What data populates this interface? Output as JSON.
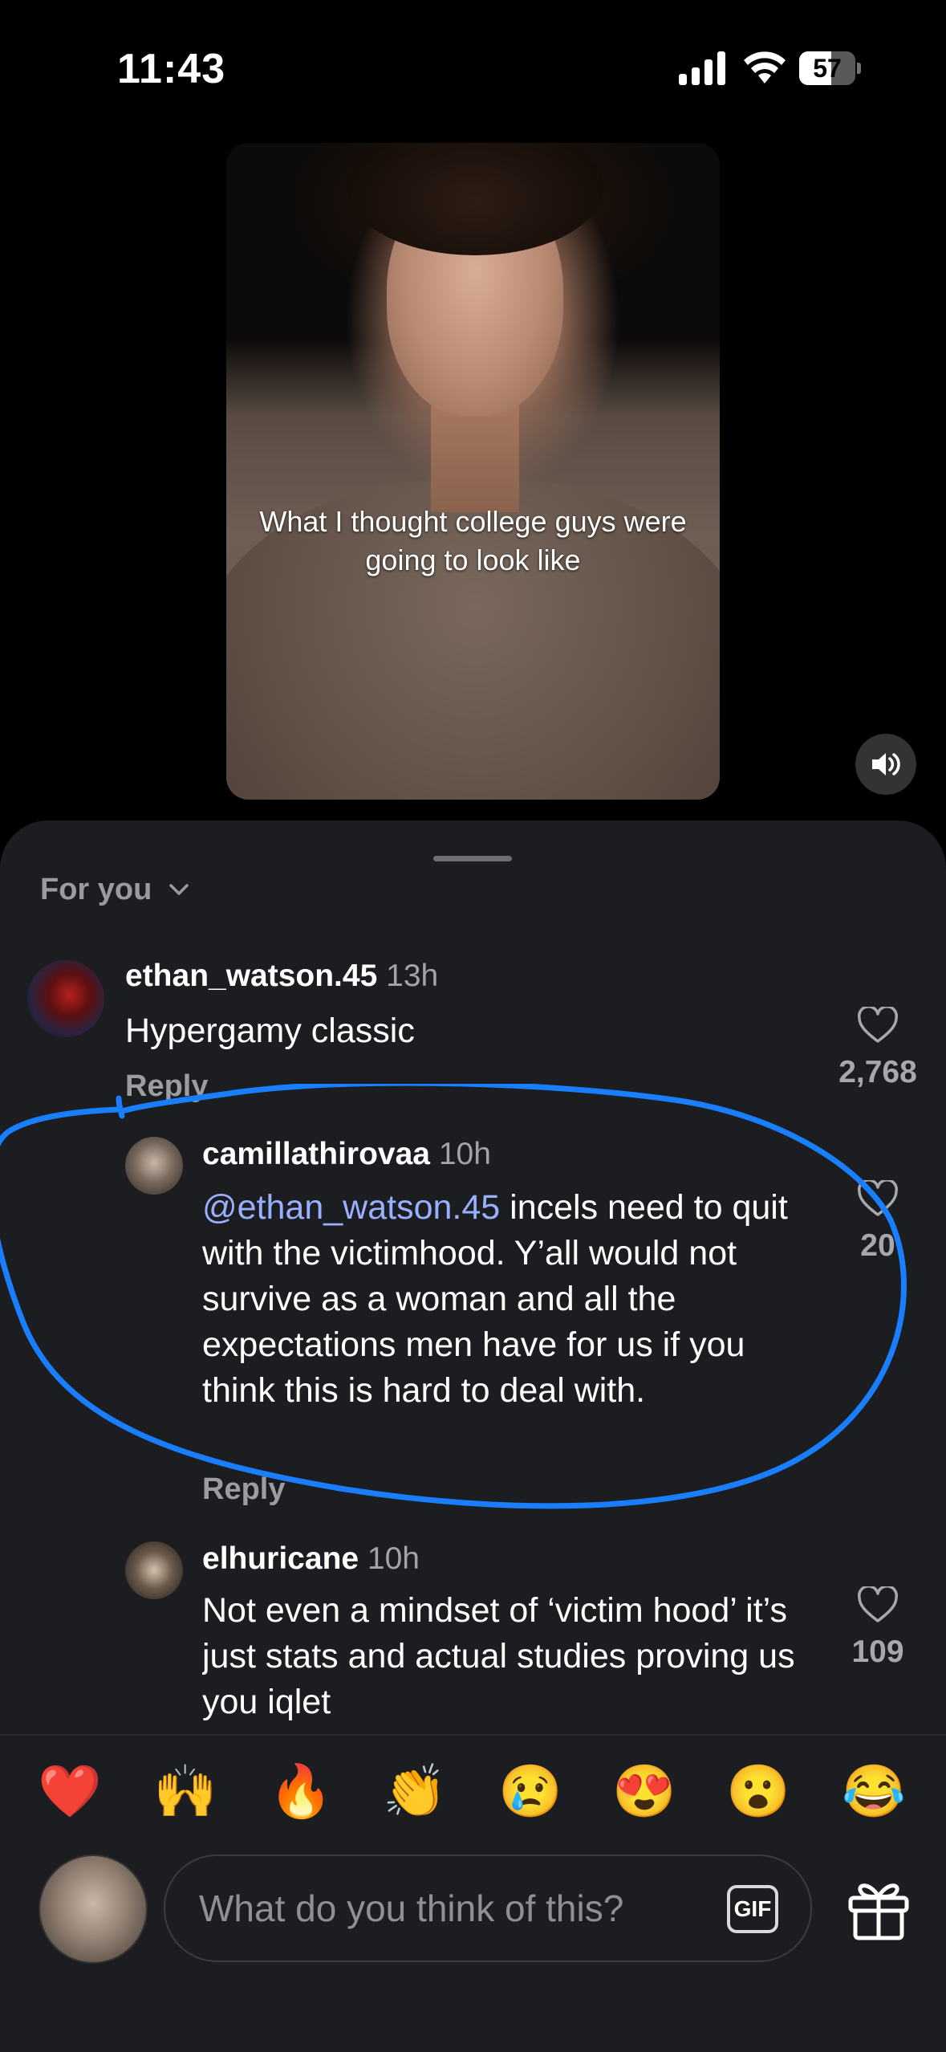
{
  "status_bar": {
    "time": "11:43",
    "battery_level": "57",
    "battery_fraction": 0.57
  },
  "video": {
    "caption": "What I thought college guys were going to look like",
    "sound_icon": "speaker-icon"
  },
  "comments_sheet": {
    "feed_selector_label": "For you",
    "comments": [
      {
        "username": "ethan_watson.45",
        "time": "13h",
        "text": "Hypergamy classic",
        "reply_label": "Reply",
        "likes": "2,768"
      },
      {
        "username": "camillathirovaa",
        "time": "10h",
        "mention": "@ethan_watson.45",
        "text": " incels need to quit with the victimhood. Y’all would not survive as a woman and all the expectations men have for us if you think this is hard to deal with.",
        "reply_label": "Reply",
        "likes": "20"
      },
      {
        "username": "elhuricane",
        "time": "10h",
        "text": "Not even a mindset of ‘victim hood’ it’s just stats and actual studies proving us you iqlet",
        "likes": "109"
      }
    ],
    "annotation_color": "#1a7fff"
  },
  "emoji_bar": [
    "❤️",
    "🙌",
    "🔥",
    "👏",
    "😢",
    "😍",
    "😮",
    "😂"
  ],
  "composer": {
    "placeholder": "What do you think of this?",
    "gif_label": "GIF",
    "gift_icon": "gift-icon"
  }
}
